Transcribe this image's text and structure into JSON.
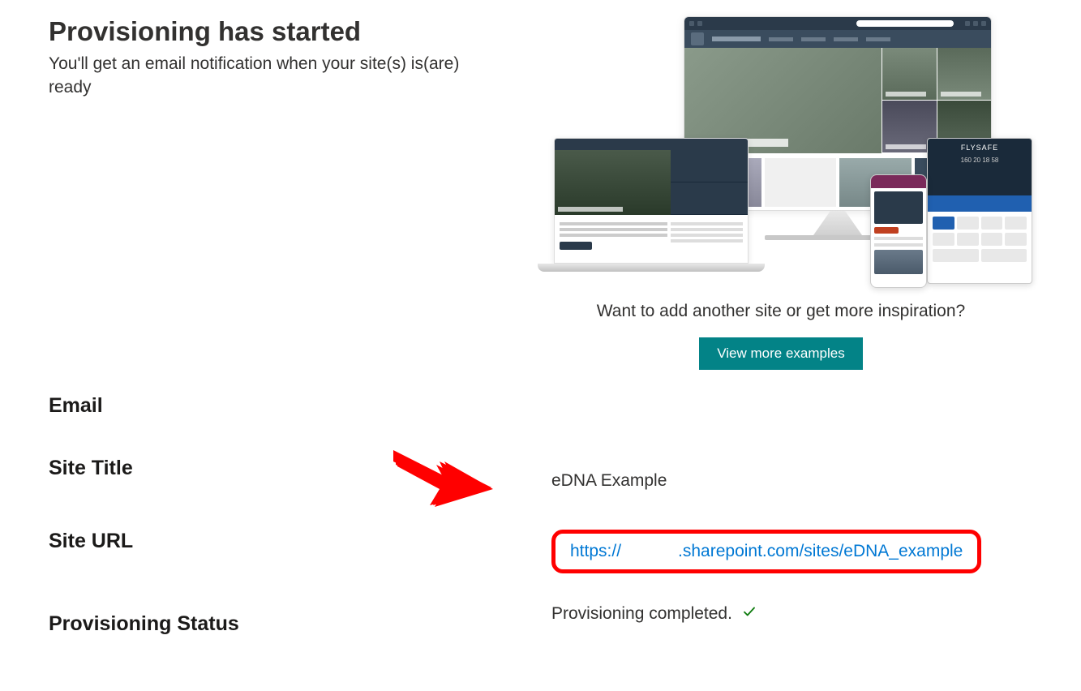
{
  "header": {
    "title": "Provisioning has started",
    "subtitle": "You'll get an email notification when your site(s) is(are) ready"
  },
  "preview": {
    "inspiration_text": "Want to add another site or get more inspiration?",
    "view_more_label": "View more examples",
    "tablet_logo": "FLYSAFE",
    "tablet_timer": "160 20 18 58"
  },
  "details": {
    "email": {
      "label": "Email",
      "value": ""
    },
    "site_title": {
      "label": "Site Title",
      "value": "eDNA Example"
    },
    "site_url": {
      "label": "Site URL",
      "url_prefix": "https://",
      "url_suffix": ".sharepoint.com/sites/eDNA_example"
    },
    "status": {
      "label": "Provisioning Status",
      "value": "Provisioning completed."
    }
  }
}
